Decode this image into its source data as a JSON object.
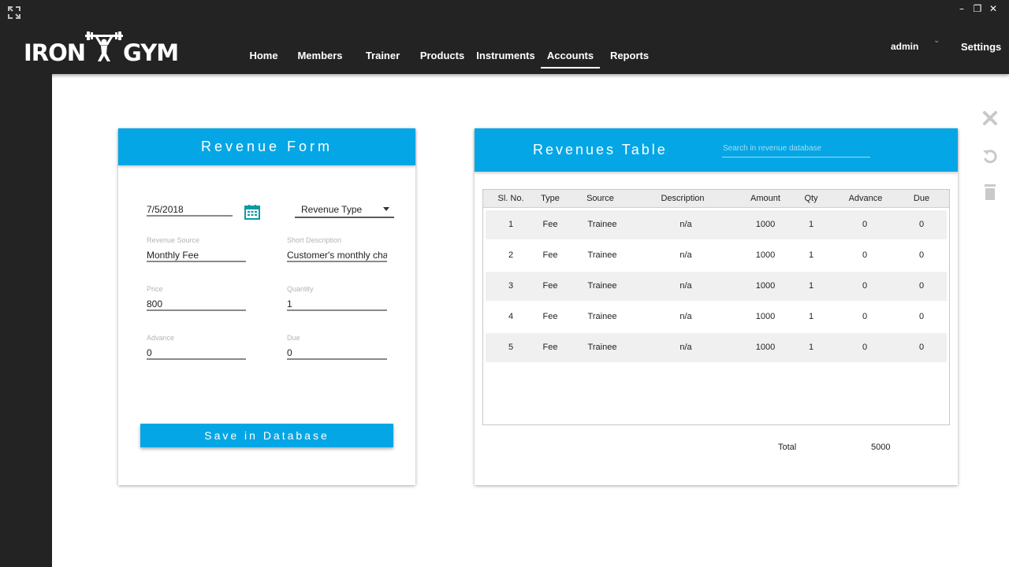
{
  "brand": {
    "word1": "IRON",
    "word2": "GYM"
  },
  "nav": {
    "items": [
      {
        "label": "Home"
      },
      {
        "label": "Members"
      },
      {
        "label": "Trainer"
      },
      {
        "label": "Products"
      },
      {
        "label": "Instruments"
      },
      {
        "label": "Accounts"
      },
      {
        "label": "Reports"
      }
    ],
    "active": "Accounts"
  },
  "user": {
    "name": "admin",
    "settings_label": "Settings"
  },
  "window_controls": {
    "minimize": "–",
    "restore": "❐"
  },
  "icons": {
    "expand": "expand-icon",
    "calendar": "calendar-icon",
    "close": "close-icon",
    "undo": "undo-icon",
    "delete": "trash-icon"
  },
  "colors": {
    "accent": "#05a6e5",
    "chrome": "#232323",
    "side_icons": "#c9c9c9"
  },
  "form": {
    "title": "Revenue Form",
    "date": "7/5/2018",
    "revenue_type_placeholder": "Revenue Type",
    "fields": {
      "revenue_source": {
        "label": "Revenue Source",
        "value": "Monthly Fee"
      },
      "short_description": {
        "label": "Short Description",
        "value": "Customer's monthly charge"
      },
      "price": {
        "label": "Price",
        "value": "800"
      },
      "quantity": {
        "label": "Quantity",
        "value": "1"
      },
      "advance": {
        "label": "Advance",
        "value": "0"
      },
      "due": {
        "label": "Due",
        "value": "0"
      }
    },
    "save_label": "Save in Database"
  },
  "table": {
    "title": "Revenues Table",
    "search_placeholder": "Search in revenue database",
    "columns": [
      "Sl. No.",
      "Type",
      "Source",
      "Description",
      "Amount",
      "Qty",
      "Advance",
      "Due"
    ],
    "rows": [
      [
        "1",
        "Fee",
        "Trainee",
        "n/a",
        "1000",
        "1",
        "0",
        "0"
      ],
      [
        "2",
        "Fee",
        "Trainee",
        "n/a",
        "1000",
        "1",
        "0",
        "0"
      ],
      [
        "3",
        "Fee",
        "Trainee",
        "n/a",
        "1000",
        "1",
        "0",
        "0"
      ],
      [
        "4",
        "Fee",
        "Trainee",
        "n/a",
        "1000",
        "1",
        "0",
        "0"
      ],
      [
        "5",
        "Fee",
        "Trainee",
        "n/a",
        "1000",
        "1",
        "0",
        "0"
      ]
    ],
    "total_label": "Total",
    "total_value": "5000"
  }
}
